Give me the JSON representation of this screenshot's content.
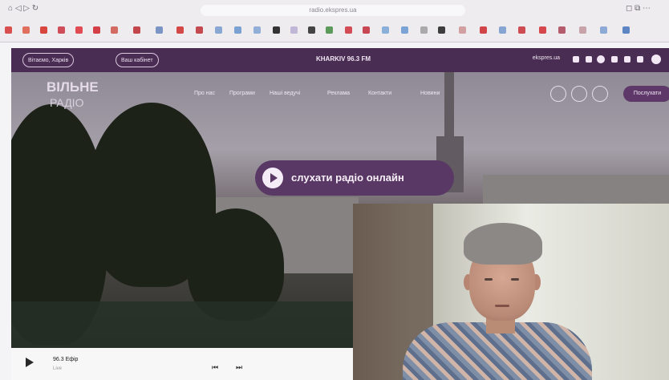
{
  "browser": {
    "address": "radio.ekspres.ua",
    "left_controls": "⌂  ◁  ▷  ↻",
    "right_controls": "◻  ⧉  ⋯"
  },
  "site": {
    "top_pills": [
      "Вітаємо, Харків",
      "Ваш кабінет"
    ],
    "frequency": "KHARKIV 96.3 FM",
    "site_domain": "ekspres.ua",
    "logo_line1": "ВІЛЬНЕ",
    "logo_line2": "РАДІО",
    "nav": [
      "Про нас",
      "Програми",
      "Наші ведучі",
      "Реклама",
      "Контакти",
      "Новини"
    ],
    "right_button": "Послухати",
    "listen_button": "слухати радіо онлайн"
  },
  "player": {
    "track_title": "96.3 Ефір",
    "track_subtitle": "Live"
  },
  "colors": {
    "brand": "#4a2d53",
    "accent": "#5a3865"
  }
}
